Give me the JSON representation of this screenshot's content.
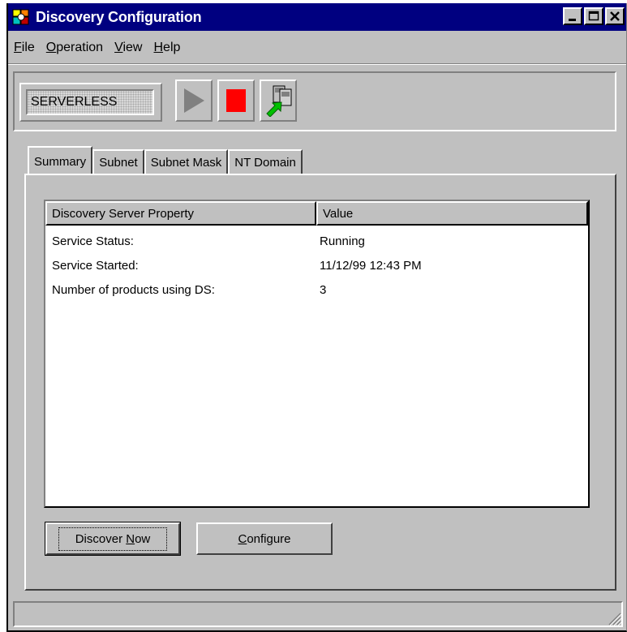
{
  "window": {
    "title": "Discovery Configuration",
    "icons": {
      "app": "discovery-app-icon",
      "minimize": "minimize-icon",
      "maximize": "maximize-icon",
      "close": "close-icon"
    }
  },
  "menu": [
    {
      "label": "File",
      "mnemonic": "F",
      "rest": "ile"
    },
    {
      "label": "Operation",
      "mnemonic": "O",
      "rest": "peration"
    },
    {
      "label": "View",
      "mnemonic": "V",
      "rest": "iew"
    },
    {
      "label": "Help",
      "mnemonic": "H",
      "rest": "elp"
    }
  ],
  "toolbar": {
    "server_name": "SERVERLESS",
    "buttons": [
      {
        "name": "start",
        "icon": "play-icon",
        "color": "#808080"
      },
      {
        "name": "stop",
        "icon": "stop-icon",
        "color": "#ff0000"
      },
      {
        "name": "connect",
        "icon": "connect-computers-icon"
      }
    ]
  },
  "tabs": [
    {
      "label": "Summary",
      "active": true
    },
    {
      "label": "Subnet",
      "active": false
    },
    {
      "label": "Subnet Mask",
      "active": false
    },
    {
      "label": "NT Domain",
      "active": false
    }
  ],
  "list": {
    "columns": [
      "Discovery Server Property",
      "Value"
    ],
    "rows": [
      {
        "property": "Service Status:",
        "value": "Running"
      },
      {
        "property": "Service Started:",
        "value": "11/12/99 12:43 PM"
      },
      {
        "property": "Number of products using DS:",
        "value": "3"
      }
    ]
  },
  "buttons": {
    "discover": {
      "pre": "Discover ",
      "mnemonic": "N",
      "post": "ow"
    },
    "configure": {
      "pre": "",
      "mnemonic": "C",
      "post": "onfigure"
    }
  },
  "colors": {
    "titlebar": "#000080",
    "face": "#c0c0c0",
    "stop": "#ff0000",
    "arrow": "#00c000"
  }
}
